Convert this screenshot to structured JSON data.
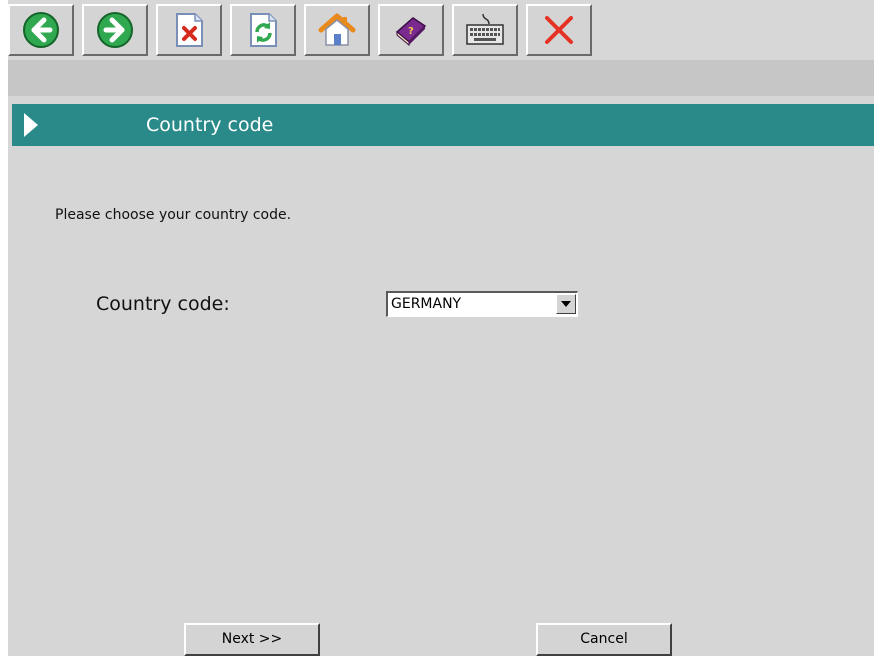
{
  "toolbar": {
    "buttons": [
      {
        "name": "back",
        "icon": "arrow-left-icon"
      },
      {
        "name": "forward",
        "icon": "arrow-right-icon"
      },
      {
        "name": "delete-document",
        "icon": "document-delete-icon"
      },
      {
        "name": "refresh-document",
        "icon": "document-refresh-icon"
      },
      {
        "name": "home",
        "icon": "home-icon"
      },
      {
        "name": "help-book",
        "icon": "help-book-icon"
      },
      {
        "name": "keyboard",
        "icon": "keyboard-icon"
      },
      {
        "name": "close",
        "icon": "close-icon"
      }
    ]
  },
  "header": {
    "title": "Country code"
  },
  "main": {
    "prompt": "Please choose your country code.",
    "country_label": "Country code:",
    "country_value": "GERMANY"
  },
  "footer": {
    "next_label": "Next >>",
    "cancel_label": "Cancel"
  },
  "colors": {
    "title_bar": "#2a8a8a",
    "background": "#d6d6d6",
    "back_forward_green": "#2fa84f",
    "close_red": "#e53224"
  }
}
